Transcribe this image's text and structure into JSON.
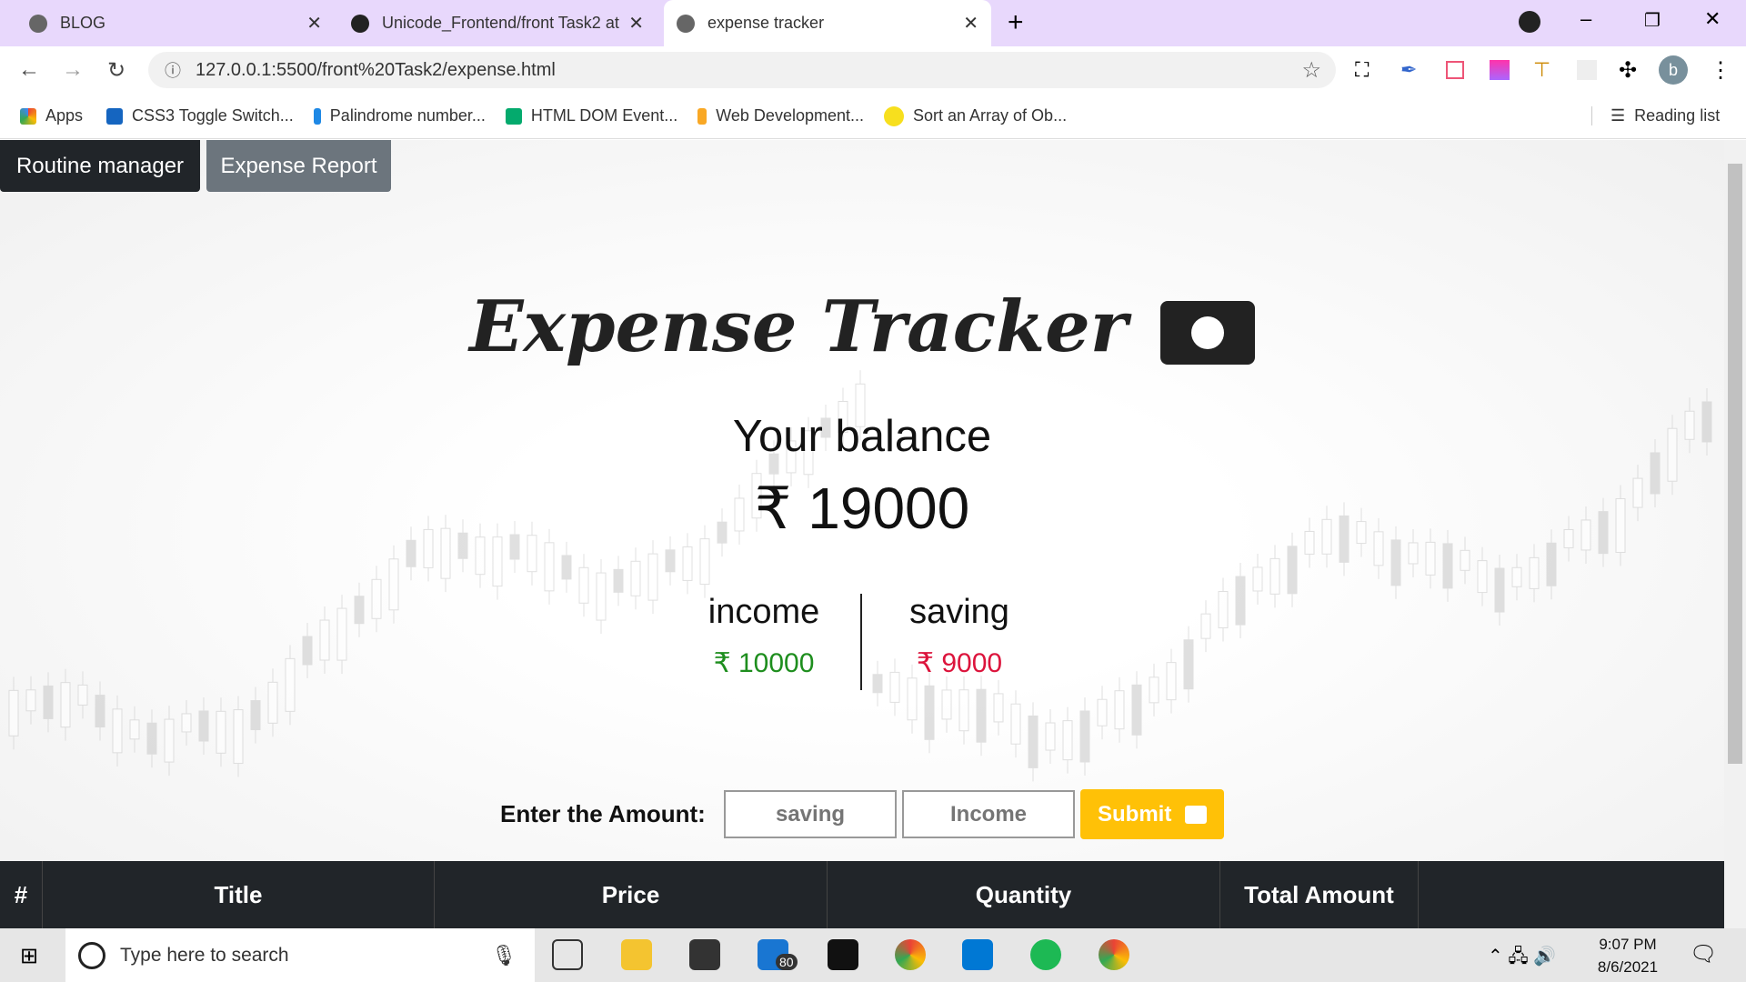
{
  "browser": {
    "tabs": [
      {
        "label": "BLOG"
      },
      {
        "label": "Unicode_Frontend/front Task2 at"
      },
      {
        "label": "expense tracker"
      }
    ],
    "url": "127.0.0.1:5500/front%20Task2/expense.html",
    "bookmarks": [
      {
        "label": "Apps",
        "color": "#ea4335"
      },
      {
        "label": "CSS3 Toggle Switch...",
        "color": "#1565c0"
      },
      {
        "label": "Palindrome number...",
        "color": "#1e88e5"
      },
      {
        "label": "HTML DOM Event...",
        "color": "#04aa6d"
      },
      {
        "label": "Web Development...",
        "color": "#f9a825"
      },
      {
        "label": "Sort an Array of Ob...",
        "color": "#f7df1e"
      }
    ],
    "reading_list": "Reading list",
    "profile": "b"
  },
  "page": {
    "nav": {
      "routine": "Routine manager",
      "expense": "Expense Report"
    },
    "title": "Expense Tracker",
    "balance_label": "Your balance",
    "balance": "₹ 19000",
    "income_label": "income",
    "income": "₹ 10000",
    "saving_label": "saving",
    "saving": "₹ 9000",
    "colors": {
      "income": "#1e8e1e",
      "saving": "#dc143c",
      "submit": "#ffc107"
    },
    "form": {
      "label": "Enter the Amount:",
      "saving_placeholder": "saving",
      "income_placeholder": "Income",
      "submit": "Submit"
    },
    "table": {
      "headers": [
        "#",
        "Title",
        "Price",
        "Quantity",
        "Total Amount"
      ]
    }
  },
  "taskbar": {
    "search_placeholder": "Type here to search",
    "mail_badge": "80",
    "time": "9:07 PM",
    "date": "8/6/2021"
  }
}
